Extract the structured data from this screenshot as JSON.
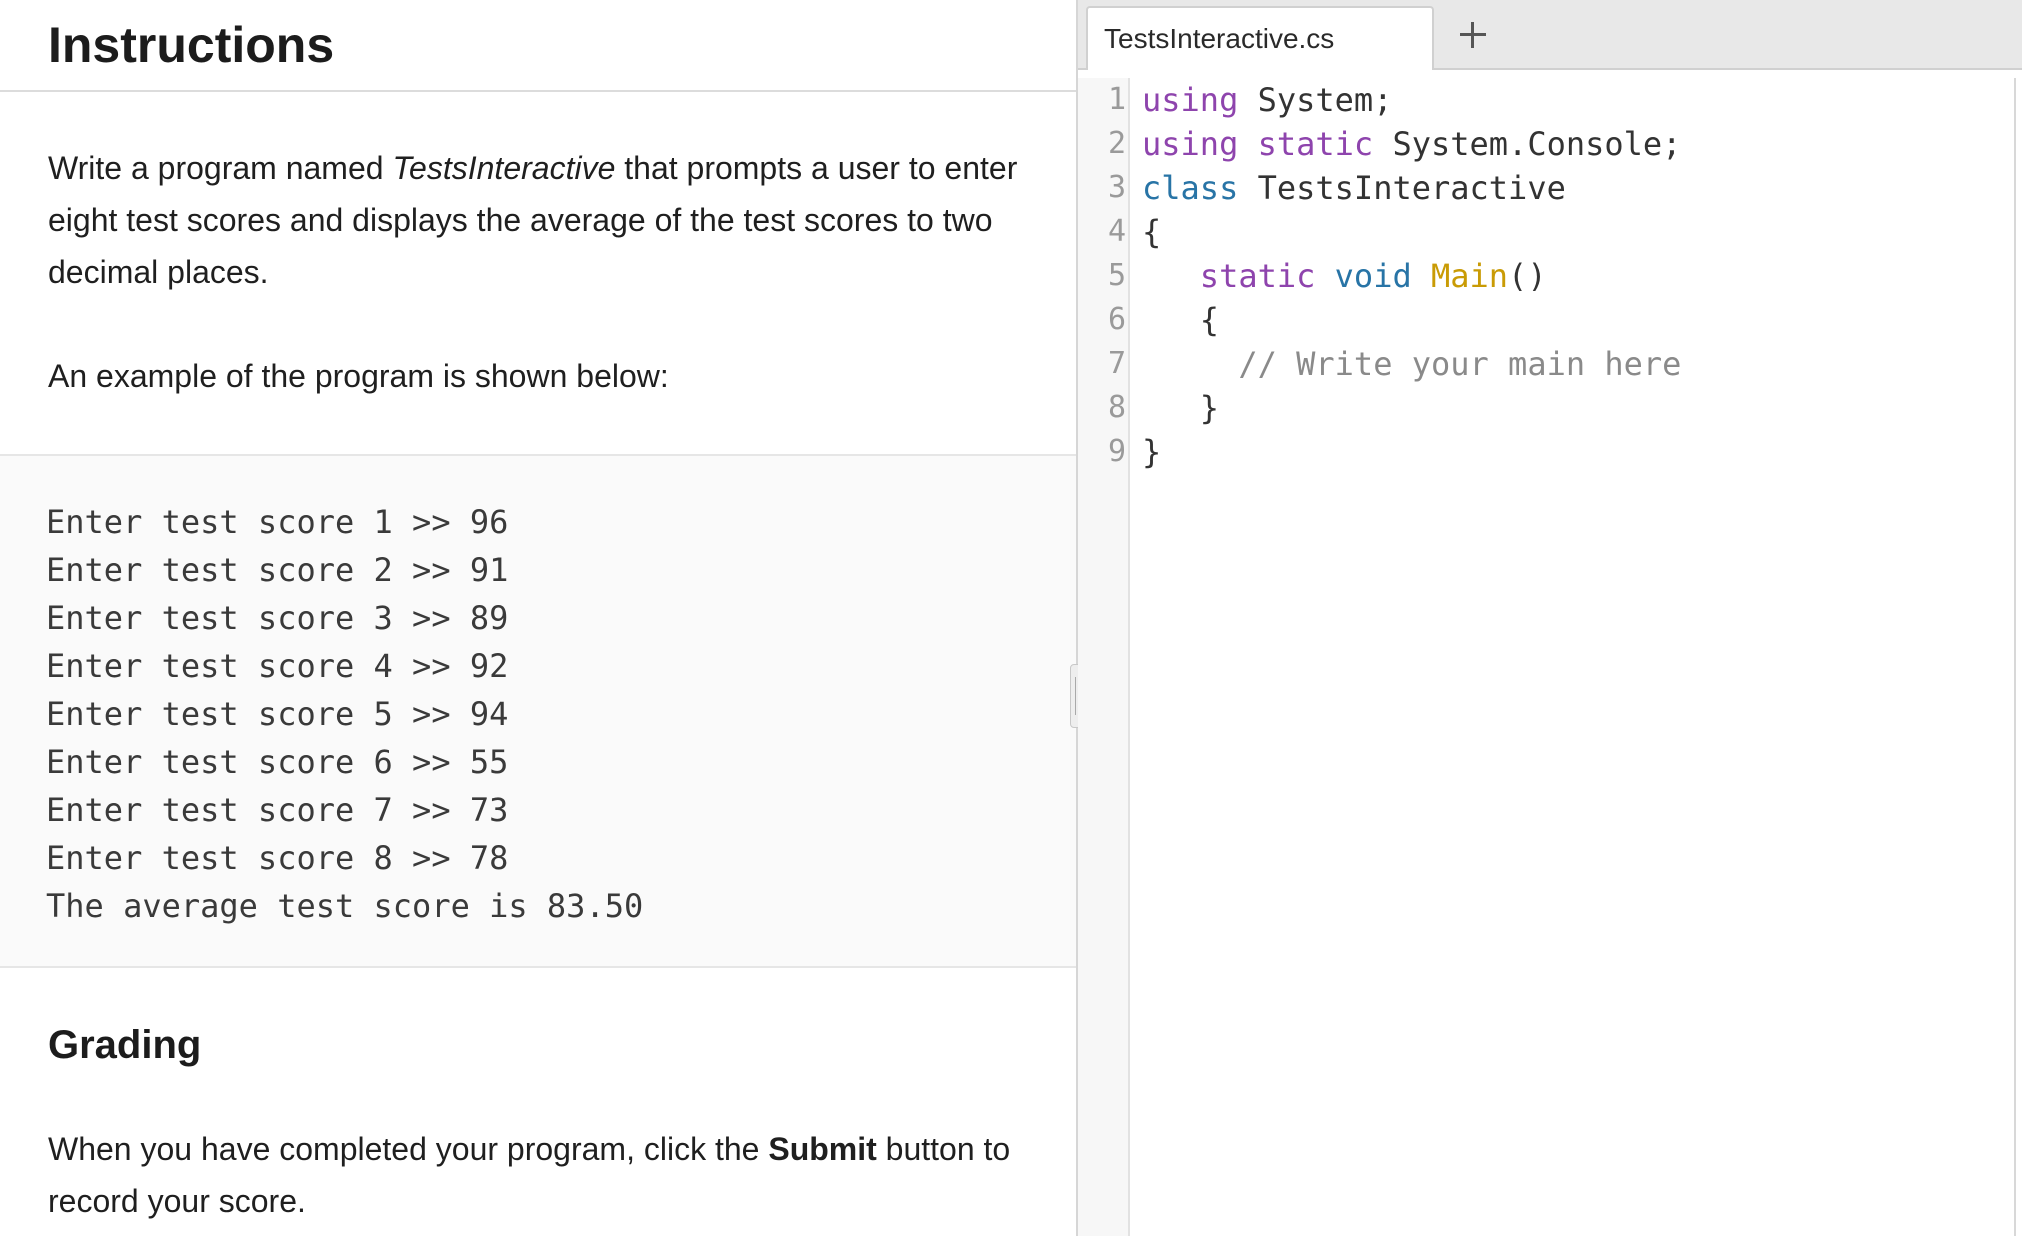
{
  "instructions": {
    "title": "Instructions",
    "intro_before": "Write a program named ",
    "intro_program_name": "TestsInteractive",
    "intro_after": " that prompts a user to enter eight test scores and displays the average of the test scores to two decimal places.",
    "example_intro": "An example of the program is shown below:",
    "example_lines": [
      "Enter test score 1 >> 96",
      "Enter test score 2 >> 91",
      "Enter test score 3 >> 89",
      "Enter test score 4 >> 92",
      "Enter test score 5 >> 94",
      "Enter test score 6 >> 55",
      "Enter test score 7 >> 73",
      "Enter test score 8 >> 78",
      "The average test score is 83.50"
    ],
    "grading_title": "Grading",
    "grading_before": "When you have completed your program, click the ",
    "grading_bold": "Submit",
    "grading_after": " button to record your score."
  },
  "editor": {
    "tab_label": "TestsInteractive.cs",
    "add_tab_icon": "plus-icon",
    "lines": [
      {
        "n": "1",
        "tokens": [
          {
            "t": "using",
            "c": "kw"
          },
          {
            "t": " System;",
            "c": "plain"
          }
        ]
      },
      {
        "n": "2",
        "tokens": [
          {
            "t": "using",
            "c": "kw"
          },
          {
            "t": " ",
            "c": "plain"
          },
          {
            "t": "static",
            "c": "kw"
          },
          {
            "t": " System.Console;",
            "c": "plain"
          }
        ]
      },
      {
        "n": "3",
        "tokens": [
          {
            "t": "class",
            "c": "type"
          },
          {
            "t": " TestsInteractive",
            "c": "plain"
          }
        ]
      },
      {
        "n": "4",
        "tokens": [
          {
            "t": "{",
            "c": "plain"
          }
        ]
      },
      {
        "n": "5",
        "tokens": [
          {
            "t": "   ",
            "c": "plain"
          },
          {
            "t": "static",
            "c": "kw"
          },
          {
            "t": " ",
            "c": "plain"
          },
          {
            "t": "void",
            "c": "type"
          },
          {
            "t": " ",
            "c": "plain"
          },
          {
            "t": "Main",
            "c": "fn"
          },
          {
            "t": "()",
            "c": "plain"
          }
        ]
      },
      {
        "n": "6",
        "tokens": [
          {
            "t": "   {",
            "c": "plain"
          }
        ]
      },
      {
        "n": "7",
        "tokens": [
          {
            "t": "     ",
            "c": "plain"
          },
          {
            "t": "// Write your main here",
            "c": "comment"
          }
        ]
      },
      {
        "n": "8",
        "tokens": [
          {
            "t": "   }",
            "c": "plain"
          }
        ]
      },
      {
        "n": "9",
        "tokens": [
          {
            "t": "}",
            "c": "plain"
          }
        ]
      }
    ]
  },
  "colors": {
    "keyword": "#8e44ad",
    "type_keyword": "#2874a6",
    "function_name": "#c99b05",
    "comment": "#8a8a8a"
  }
}
